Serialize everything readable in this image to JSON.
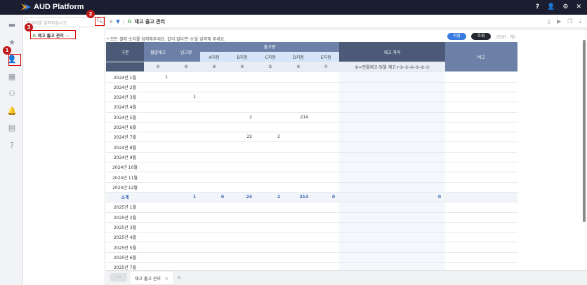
{
  "app": {
    "title": "AUD Platform",
    "top_icons": [
      "help-icon",
      "user-icon",
      "gear-icon",
      "close-icon"
    ],
    "top_glyphs": [
      "?",
      "👤",
      "⚙",
      "✕"
    ]
  },
  "sidebar": {
    "icons": [
      "folder-icon",
      "star-icon",
      "user-icon",
      "dashboard-icon",
      "org-chart-icon",
      "bell-icon",
      "clipboard-icon",
      "help-icon"
    ]
  },
  "tree": {
    "search_placeholder": "검색어를 입력하십시오.",
    "node_label": "재고 출고 관리"
  },
  "callouts": [
    "1",
    "2",
    "3"
  ],
  "main": {
    "breadcrumb": "재고 출고 관리",
    "note": "* 모든 셀에 숫자를 입력해주세요. 값이 없다면 '0'을 입력해 주세요.",
    "save_label": "저장",
    "search_label": "조회",
    "unit": "(단위 : 개)",
    "colors": {
      "save": "#3a7be0",
      "search": "#23272f"
    },
    "headers": {
      "category": "구분",
      "month_end": "월말재고",
      "inbound": "입고량",
      "outbound": "출고량",
      "branches": [
        "A지점",
        "B지점",
        "C지점",
        "D지점",
        "E지점"
      ],
      "diff": "재고 차이",
      "remark": "비고",
      "markers": [
        "①",
        "②",
        "③",
        "④",
        "⑤",
        "⑥",
        "⑦"
      ],
      "formula": "⑧=전월재고-당월 재고+②-③-④-⑤-⑥-⑦"
    },
    "rows2024": [
      {
        "label": "2024년 1월",
        "v": [
          "1",
          "",
          "",
          "",
          "",
          "",
          ""
        ]
      },
      {
        "label": "2024년 2월",
        "v": [
          "",
          "",
          "",
          "",
          "",
          "",
          ""
        ]
      },
      {
        "label": "2024년 3월",
        "v": [
          "",
          "1",
          "",
          "",
          "",
          "",
          ""
        ]
      },
      {
        "label": "2024년 4월",
        "v": [
          "",
          "",
          "",
          "",
          "",
          "",
          ""
        ]
      },
      {
        "label": "2024년 5월",
        "v": [
          "",
          "",
          "",
          "2",
          "",
          "214",
          ""
        ]
      },
      {
        "label": "2024년 6월",
        "v": [
          "",
          "",
          "",
          "",
          "",
          "",
          ""
        ]
      },
      {
        "label": "2024년 7월",
        "v": [
          "",
          "",
          "",
          "22",
          "2",
          "",
          ""
        ]
      },
      {
        "label": "2024년 8월",
        "v": [
          "",
          "",
          "",
          "",
          "",
          "",
          ""
        ]
      },
      {
        "label": "2024년 9월",
        "v": [
          "",
          "",
          "",
          "",
          "",
          "",
          ""
        ]
      },
      {
        "label": "2024년 10월",
        "v": [
          "",
          "",
          "",
          "",
          "",
          "",
          ""
        ]
      },
      {
        "label": "2024년 11월",
        "v": [
          "",
          "",
          "",
          "",
          "",
          "",
          ""
        ]
      },
      {
        "label": "2024년 12월",
        "v": [
          "",
          "",
          "",
          "",
          "",
          "",
          ""
        ]
      }
    ],
    "subtotal": {
      "label": "소계",
      "v": [
        "",
        "1",
        "0",
        "24",
        "2",
        "214",
        "0"
      ],
      "diff": "0"
    },
    "rows2025": [
      "2025년 1월",
      "2025년 2월",
      "2025년 3월",
      "2025년 4월",
      "2025년 5월",
      "2025년 6월",
      "2025년 7월"
    ],
    "tab_label": "재고 출고 관리"
  }
}
